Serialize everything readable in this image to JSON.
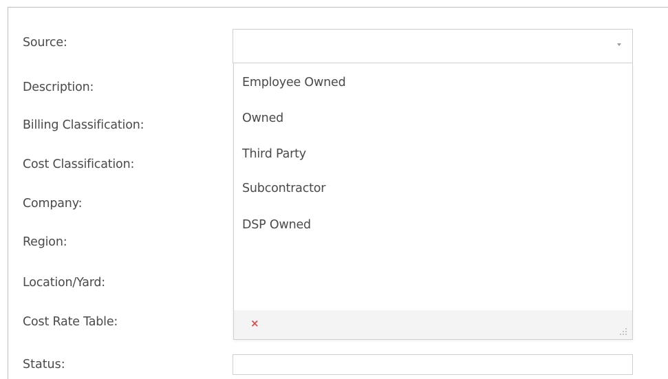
{
  "form": {
    "labels": [
      "Source:",
      "Description:",
      "Billing Classification:",
      "Cost Classification:",
      "Company:",
      "Region:",
      "Location/Yard:",
      "Cost Rate Table:",
      "Status:"
    ]
  },
  "source_select": {
    "value": "",
    "arrow_icon": "chevron-down-icon",
    "options": [
      "Employee Owned",
      "Owned",
      "Third Party",
      "Subcontractor",
      "DSP Owned"
    ],
    "clear_icon": "×",
    "clear_color": "#e04a4a"
  }
}
